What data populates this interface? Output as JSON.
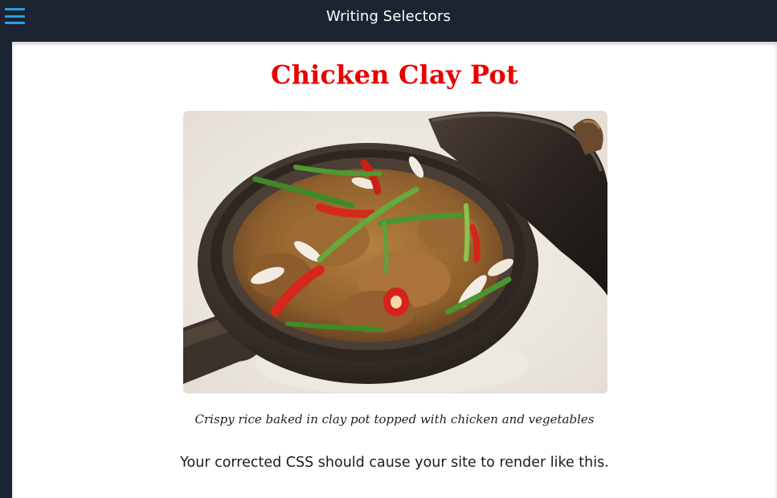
{
  "header": {
    "title": "Writing Selectors",
    "menu_icon": "hamburger-menu-icon",
    "accent_color": "#2e9ee6",
    "background_color": "#1b2430"
  },
  "page": {
    "heading": "Chicken Clay Pot",
    "heading_color": "#e60000",
    "image_subject": "chicken and vegetables in an open clay pot",
    "caption": "Crispy rice baked in clay pot topped with chicken and vegetables",
    "note": "Your corrected CSS should cause your site to render like this."
  }
}
